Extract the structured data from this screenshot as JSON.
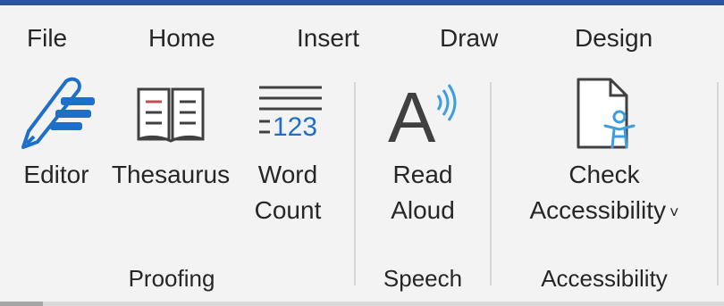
{
  "tabs": [
    "File",
    "Home",
    "Insert",
    "Draw",
    "Design"
  ],
  "groups": {
    "proofing": {
      "label": "Proofing",
      "buttons": {
        "editor": "Editor",
        "thesaurus": "Thesaurus",
        "word_count_line1": "Word",
        "word_count_line2": "Count",
        "word_count_icon_text": "123"
      }
    },
    "speech": {
      "label": "Speech",
      "buttons": {
        "read_aloud_line1": "Read",
        "read_aloud_line2": "Aloud",
        "read_aloud_icon_text": "A"
      }
    },
    "accessibility": {
      "label": "Accessibility",
      "buttons": {
        "check_line1": "Check",
        "check_line2": "Accessibility",
        "check_caret": "˅"
      }
    }
  },
  "colors": {
    "accent": "#2b579a",
    "icon_blue": "#1e6fc9",
    "icon_light_blue": "#3c9ee0",
    "icon_red": "#c0504d",
    "icon_dark": "#404040"
  },
  "icons": {
    "editor": "pen-icon",
    "thesaurus": "book-icon",
    "word_count": "word-count-icon",
    "read_aloud": "read-aloud-icon",
    "check_accessibility": "accessibility-check-icon"
  }
}
